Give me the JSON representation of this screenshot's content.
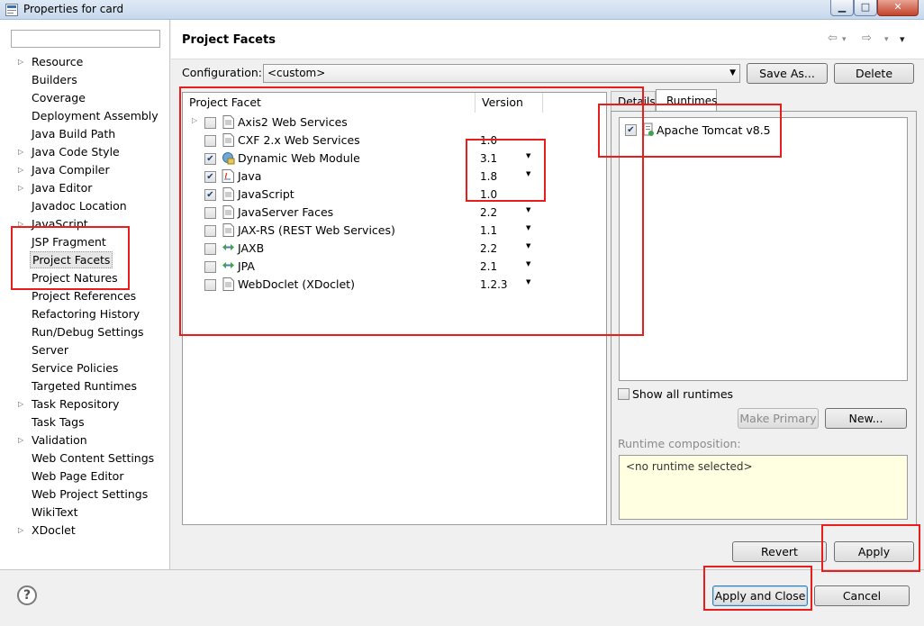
{
  "window": {
    "title": "Properties for card",
    "minimize": "▁",
    "maximize": "□",
    "close": "✕"
  },
  "sidebar": {
    "filter_value": "",
    "items": [
      {
        "label": "Resource",
        "expandable": true
      },
      {
        "label": "Builders",
        "expandable": false
      },
      {
        "label": "Coverage",
        "expandable": false
      },
      {
        "label": "Deployment Assembly",
        "expandable": false
      },
      {
        "label": "Java Build Path",
        "expandable": false
      },
      {
        "label": "Java Code Style",
        "expandable": true
      },
      {
        "label": "Java Compiler",
        "expandable": true
      },
      {
        "label": "Java Editor",
        "expandable": true
      },
      {
        "label": "Javadoc Location",
        "expandable": false
      },
      {
        "label": "JavaScript",
        "expandable": true
      },
      {
        "label": "JSP Fragment",
        "expandable": false
      },
      {
        "label": "Project Facets",
        "expandable": false
      },
      {
        "label": "Project Natures",
        "expandable": false
      },
      {
        "label": "Project References",
        "expandable": false
      },
      {
        "label": "Refactoring History",
        "expandable": false
      },
      {
        "label": "Run/Debug Settings",
        "expandable": false
      },
      {
        "label": "Server",
        "expandable": false
      },
      {
        "label": "Service Policies",
        "expandable": false
      },
      {
        "label": "Targeted Runtimes",
        "expandable": false
      },
      {
        "label": "Task Repository",
        "expandable": true
      },
      {
        "label": "Task Tags",
        "expandable": false
      },
      {
        "label": "Validation",
        "expandable": true
      },
      {
        "label": "Web Content Settings",
        "expandable": false
      },
      {
        "label": "Web Page Editor",
        "expandable": false
      },
      {
        "label": "Web Project Settings",
        "expandable": false
      },
      {
        "label": "WikiText",
        "expandable": false
      },
      {
        "label": "XDoclet",
        "expandable": true
      }
    ],
    "selected": "Project Facets"
  },
  "header": {
    "title": "Project Facets",
    "back_icon": "⇦",
    "forward_icon": "⇨",
    "menu_icon": "▾"
  },
  "configuration": {
    "label": "Configuration:",
    "value": "<custom>",
    "save_as": "Save As...",
    "delete": "Delete"
  },
  "facets": {
    "column_facet": "Project Facet",
    "column_version": "Version",
    "rows": [
      {
        "name": "Axis2 Web Services",
        "version": "",
        "checked": false,
        "expandable": true,
        "icon": "page-icon",
        "has_dropdown": false
      },
      {
        "name": "CXF 2.x Web Services",
        "version": "1.0",
        "checked": false,
        "expandable": false,
        "icon": "page-icon",
        "has_dropdown": false
      },
      {
        "name": "Dynamic Web Module",
        "version": "3.1",
        "checked": true,
        "expandable": false,
        "icon": "web-module-icon",
        "has_dropdown": true
      },
      {
        "name": "Java",
        "version": "1.8",
        "checked": true,
        "expandable": false,
        "icon": "java-icon",
        "has_dropdown": true
      },
      {
        "name": "JavaScript",
        "version": "1.0",
        "checked": true,
        "expandable": false,
        "icon": "page-icon",
        "has_dropdown": false
      },
      {
        "name": "JavaServer Faces",
        "version": "2.2",
        "checked": false,
        "expandable": false,
        "icon": "page-icon",
        "has_dropdown": true
      },
      {
        "name": "JAX-RS (REST Web Services)",
        "version": "1.1",
        "checked": false,
        "expandable": false,
        "icon": "page-icon",
        "has_dropdown": true
      },
      {
        "name": "JAXB",
        "version": "2.2",
        "checked": false,
        "expandable": false,
        "icon": "jaxb-icon",
        "has_dropdown": true
      },
      {
        "name": "JPA",
        "version": "2.1",
        "checked": false,
        "expandable": false,
        "icon": "jpa-icon",
        "has_dropdown": true
      },
      {
        "name": "WebDoclet (XDoclet)",
        "version": "1.2.3",
        "checked": false,
        "expandable": false,
        "icon": "page-icon",
        "has_dropdown": true
      }
    ]
  },
  "tabs": {
    "details": "Details",
    "runtimes": "Runtimes"
  },
  "runtimes": {
    "items": [
      {
        "name": "Apache Tomcat v8.5",
        "checked": true
      }
    ],
    "show_all": "Show all runtimes",
    "make_primary": "Make Primary",
    "new": "New...",
    "composition_label": "Runtime composition:",
    "composition_value": "<no runtime selected>"
  },
  "buttons": {
    "revert": "Revert",
    "apply": "Apply",
    "apply_and_close": "Apply and Close",
    "cancel": "Cancel"
  },
  "help_icon": "?",
  "annotation_color": "#ea1d1d"
}
